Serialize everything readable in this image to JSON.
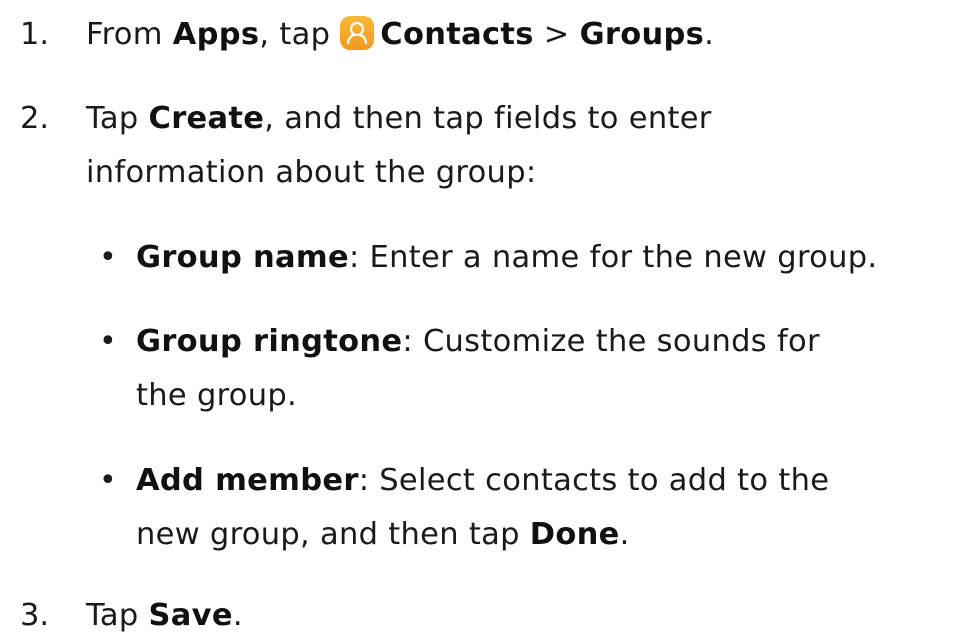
{
  "steps": [
    {
      "number": "1.",
      "prefix": "From ",
      "apps": "Apps",
      "tap": ", tap ",
      "contacts": "Contacts",
      "sep": " > ",
      "groups": "Groups",
      "end": "."
    },
    {
      "number": "2.",
      "prefix": "Tap ",
      "create": "Create",
      "rest_line1": ", and then tap fields to enter",
      "line2": "information about the group:"
    },
    {
      "number": "3.",
      "prefix": "Tap ",
      "save": "Save",
      "end": "."
    }
  ],
  "bullets": [
    {
      "symbol": "•",
      "term": "Group name",
      "desc_line1": ": Enter a name for the new group."
    },
    {
      "symbol": "•",
      "term": "Group ringtone",
      "desc_line1": ": Customize the sounds for",
      "desc_line2": "the group."
    },
    {
      "symbol": "•",
      "term": "Add member",
      "desc_line1": ": Select contacts to add to the",
      "desc_line2_prefix": "new group, and then tap ",
      "done": "Done",
      "end": "."
    }
  ],
  "icons": {
    "contacts_icon": "contacts-app-icon",
    "contacts_icon_color": "#f5a623"
  }
}
